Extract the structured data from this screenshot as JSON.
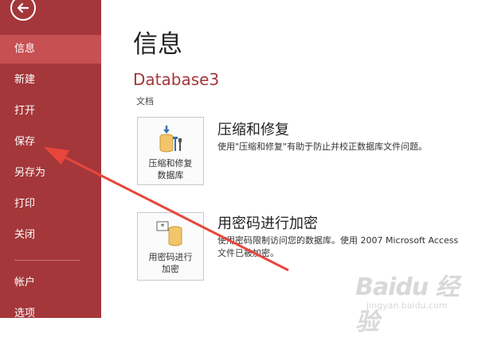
{
  "sidebar": {
    "items": [
      {
        "label": "信息",
        "active": true
      },
      {
        "label": "新建"
      },
      {
        "label": "打开"
      },
      {
        "label": "保存"
      },
      {
        "label": "另存为"
      },
      {
        "label": "打印"
      },
      {
        "label": "关闭"
      },
      {
        "label": "帐户"
      },
      {
        "label": "选项"
      }
    ]
  },
  "main": {
    "title": "信息",
    "database_name": "Database3",
    "section_label": "文档",
    "compact": {
      "button_label_1": "压缩和修复",
      "button_label_2": "数据库",
      "heading": "压缩和修复",
      "description": "使用\"压缩和修复\"有助于防止并校正数据库文件问题。"
    },
    "encrypt": {
      "button_label_1": "用密码进行",
      "button_label_2": "加密",
      "heading": "用密码进行加密",
      "description_1": "使用密码限制访问您的数据库。使用 2007 Microsoft Access",
      "description_2": "文件已被加密。"
    }
  },
  "watermark": {
    "logo": "Baidu 经验",
    "url": "jingyan.baidu.com"
  },
  "colors": {
    "sidebar": "#a4373a",
    "sidebar_active": "#c75052",
    "accent_text": "#a4373a",
    "annotation_arrow": "#e8463a"
  }
}
